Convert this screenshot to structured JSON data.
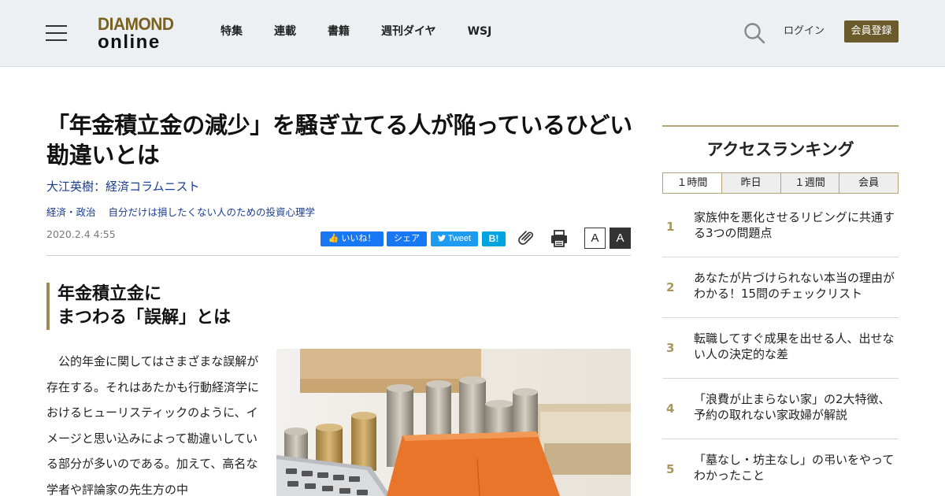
{
  "header": {
    "logo_line1": "DIAMOND",
    "logo_line2": "online",
    "nav": [
      "特集",
      "連載",
      "書籍",
      "週刊ダイヤ",
      "WSJ"
    ],
    "login": "ログイン",
    "register": "会員登録",
    "brand_color": "#6b5a2b"
  },
  "article": {
    "title": "「年金積立金の減少」を騒ぎ立てる人が陥っているひどい勘違いとは",
    "author": "大江英樹：経済コラムニスト",
    "tags": [
      "経済・政治",
      "自分だけは損したくない人のための投資心理学"
    ],
    "date": "2020.2.4 4:55",
    "share": {
      "like": "いいね！",
      "share": "シェア",
      "tweet": "Tweet",
      "hatena": "B!"
    },
    "font_small": "A",
    "font_large": "A",
    "subhead_line1": "年金積立金に",
    "subhead_line2": "まつわる「誤解」とは",
    "body": "公的年金に関してはさまざまな誤解が存在する。それはあたかも行動経済学におけるヒューリスティックのように、イメージと思い込みによって勘違いしている部分が多いのである。加えて、高名な学者や評論家の先生方の中"
  },
  "ranking": {
    "title": "アクセスランキング",
    "tabs": [
      "１時間",
      "昨日",
      "１週間",
      "会員"
    ],
    "active_tab": 0,
    "items": [
      {
        "rank": "1",
        "text": "家族仲を悪化させるリビングに共通する3つの問題点"
      },
      {
        "rank": "2",
        "text": "あなたが片づけられない本当の理由がわかる！15問のチェックリスト"
      },
      {
        "rank": "3",
        "text": "転職してすぐ成果を出せる人、出せない人の決定的な差"
      },
      {
        "rank": "4",
        "text": "「浪費が止まらない家」の2大特徴、予約の取れない家政婦が解説"
      },
      {
        "rank": "5",
        "text": "「墓なし・坊主なし」の弔いをやってわかったこと"
      }
    ]
  }
}
